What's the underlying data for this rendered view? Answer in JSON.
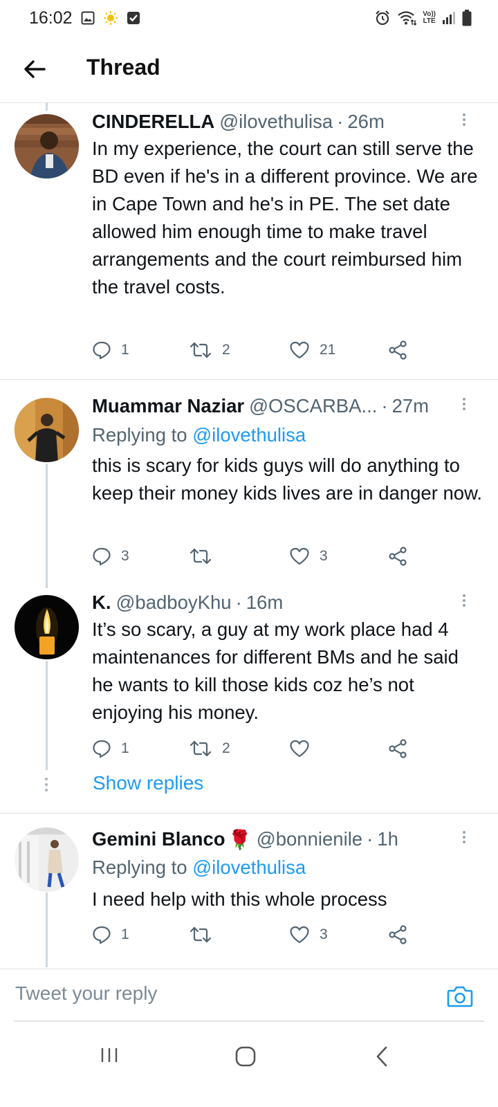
{
  "status_bar": {
    "time": "16:02",
    "left_icons": [
      "image-icon",
      "sun-icon",
      "check-box-icon"
    ],
    "right_icons": [
      "alarm-icon",
      "wifi-icon",
      "volte-icon",
      "signal-icon",
      "battery-icon"
    ],
    "volte_top": "Vo))",
    "volte_bottom": "LTE"
  },
  "app_bar": {
    "title": "Thread",
    "back_icon": "arrow-left-icon"
  },
  "tweets": [
    {
      "name": "CINDERELLA",
      "handle": "@ilovethulisa",
      "dot": "·",
      "time": "26m",
      "text": "In my experience, the court can still serve the BD even if he's in a different province. We are in Cape Town and he's in PE. The set date allowed him enough time to make travel arrangements and the court reimbursed him the travel costs.",
      "replies": "1",
      "retweets": "2",
      "likes": "21"
    },
    {
      "name": "Muammar Naziar",
      "handle": "@OSCARBA...",
      "dot": "·",
      "time": "27m",
      "replying_label": "Replying to",
      "replying_handle": "@ilovethulisa",
      "text": "this is scary for kids guys will do anything to keep their money kids lives are in danger now.",
      "replies": "3",
      "retweets": "",
      "likes": "3"
    },
    {
      "name": "K.",
      "handle": "@badboyKhu",
      "dot": "·",
      "time": "16m",
      "text": "It’s so scary, a guy at my work place had 4 maintenances for different BMs and he said he wants to kill those kids coz he’s not enjoying his money.",
      "replies": "1",
      "retweets": "2",
      "likes": "",
      "show_replies": "Show replies"
    },
    {
      "name": "Gemini Blanco",
      "name_emoji": "🌹",
      "handle": "@bonnienile",
      "dot": "·",
      "time": "1h",
      "replying_label": "Replying to",
      "replying_handle": "@ilovethulisa",
      "text": "I need help with this whole process",
      "replies": "1",
      "retweets": "",
      "likes": "3"
    }
  ],
  "composer": {
    "placeholder": "Tweet your reply",
    "camera_icon": "camera-icon"
  },
  "nav_bar": {
    "icons": [
      "recent-apps-icon",
      "home-icon",
      "back-icon"
    ]
  },
  "colors": {
    "accent": "#1d9bf0",
    "text_primary": "#0f1419",
    "text_secondary": "#536471",
    "divider": "#dfe3e6",
    "thread_line": "#cfd9de"
  }
}
